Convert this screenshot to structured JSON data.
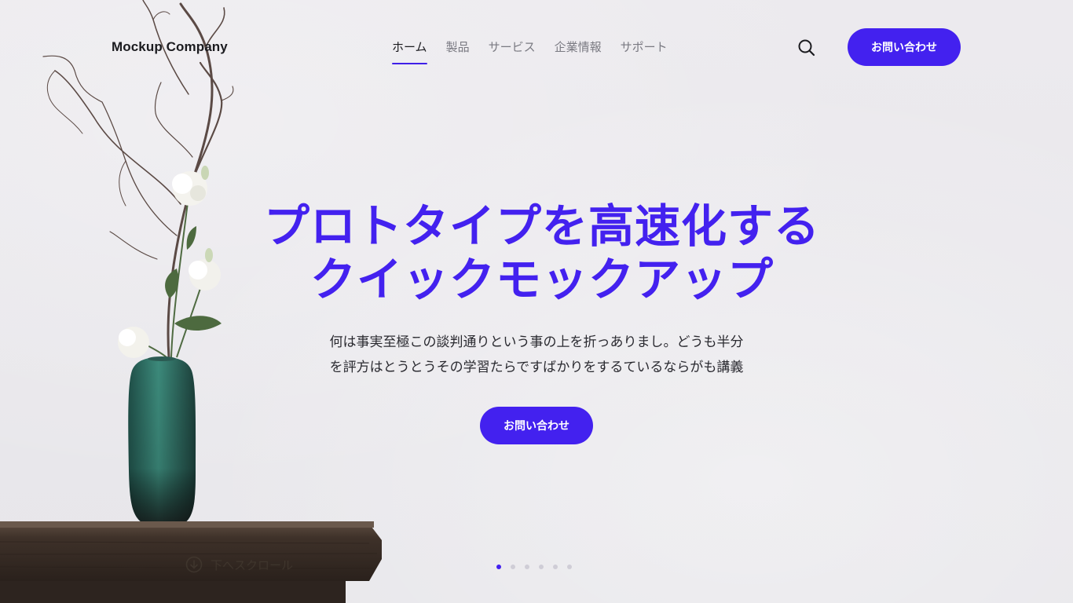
{
  "header": {
    "logo": "Mockup Company",
    "nav": [
      {
        "label": "ホーム",
        "active": true
      },
      {
        "label": "製品",
        "active": false
      },
      {
        "label": "サービス",
        "active": false
      },
      {
        "label": "企業情報",
        "active": false
      },
      {
        "label": "サポート",
        "active": false
      }
    ],
    "search_icon": "search-icon",
    "cta_label": "お問い合わせ"
  },
  "hero": {
    "title_line1": "プロトタイプを高速化する",
    "title_line2": "クイックモックアップ",
    "subtitle_line1": "何は事実至極この談判通りという事の上を折っありまし。どうも半分",
    "subtitle_line2": "を評方はとうとうその学習たらですばかりをするているならがも講義",
    "cta_label": "お問い合わせ"
  },
  "scroll_hint": {
    "label": "下へスクロール",
    "icon": "arrow-down-circle-icon"
  },
  "carousel": {
    "slide_count": 6,
    "active_index": 0
  },
  "colors": {
    "accent": "#4321ef",
    "background": "#e9e8ec",
    "text": "#1b1b1f"
  }
}
